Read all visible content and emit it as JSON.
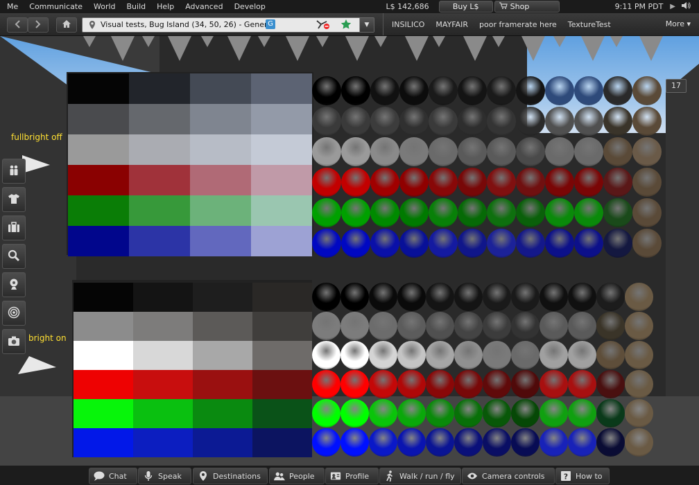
{
  "menubar": {
    "items": [
      "Me",
      "Communicate",
      "World",
      "Build",
      "Help",
      "Advanced",
      "Develop"
    ],
    "balance": "L$ 142,686",
    "buy_label": "Buy L$",
    "shop_label": "Shop",
    "clock": "9:11 PM PDT"
  },
  "navbar": {
    "location": "Visual tests, Bug Island (34, 50, 26) - General",
    "maturity_badge": "G",
    "favorites": [
      "INSILICO",
      "MAYFAIR",
      "poor framerate here",
      "TextureTest"
    ],
    "more_label": "More"
  },
  "scene": {
    "label_top": "fullbright off",
    "label_bottom": "bright on",
    "counter": "17"
  },
  "bottom_toolbar": {
    "buttons": [
      "Chat",
      "Speak",
      "Destinations",
      "People",
      "Profile",
      "Walk / run / fly",
      "Camera controls",
      "How to"
    ]
  },
  "icons": {
    "back": "back-arrow-icon",
    "forward": "forward-arrow-icon",
    "home": "home-icon",
    "left_toolbar": [
      "people-icon",
      "appearance-icon",
      "inventory-icon",
      "search-icon",
      "snapshot-icon",
      "radar-icon",
      "camera-icon"
    ]
  }
}
